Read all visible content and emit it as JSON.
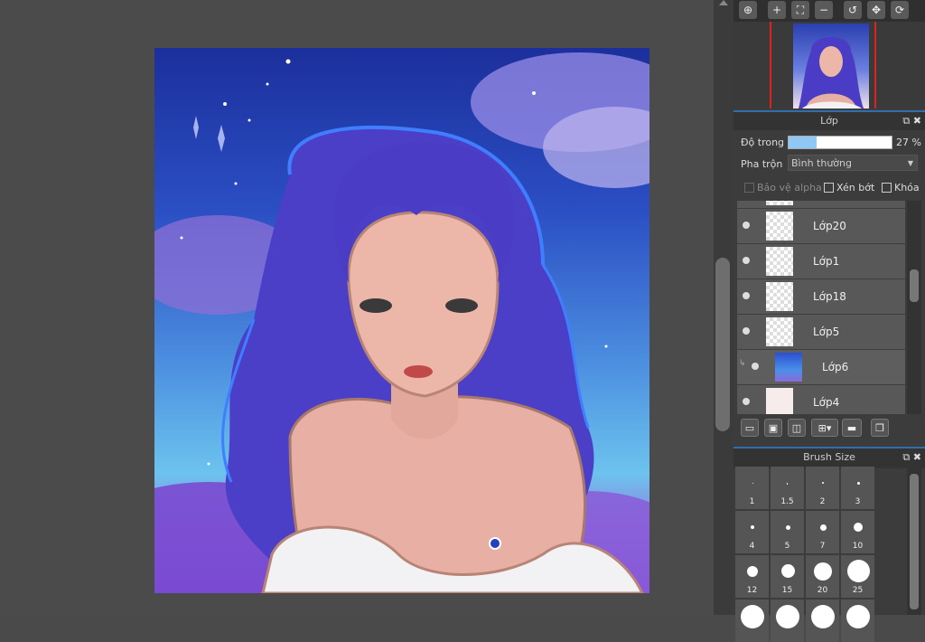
{
  "navigator": {
    "toolbar_icons": [
      "zoom-actual-icon",
      "zoom-in-icon",
      "fit-window-icon",
      "zoom-out-icon",
      "rotate-left-icon",
      "fullscreen-icon",
      "rotate-reset-icon"
    ]
  },
  "layer_panel": {
    "title": "Lớp",
    "opacity_label": "Độ trong",
    "opacity_value": "27 %",
    "opacity_fraction": 0.27,
    "blend_label": "Pha trộn",
    "blend_value": "Bình thường",
    "protect_alpha_label": "Bảo vệ alpha",
    "clipping_label": "Xén bớt",
    "lock_label": "Khóa",
    "layers": [
      {
        "name": "Lớp20",
        "thumb": "empty"
      },
      {
        "name": "Lớp1",
        "thumb": "empty"
      },
      {
        "name": "Lớp18",
        "thumb": "empty"
      },
      {
        "name": "Lớp5",
        "thumb": "empty"
      },
      {
        "name": "Lớp6",
        "thumb": "gradient"
      },
      {
        "name": "Lớp4",
        "thumb": "sketch"
      }
    ]
  },
  "brush_panel": {
    "title": "Brush Size",
    "sizes": [
      "1",
      "1.5",
      "2",
      "3",
      "4",
      "5",
      "7",
      "10",
      "12",
      "15",
      "20",
      "25"
    ]
  },
  "colors": {
    "accent": "#2f6fb0",
    "opacity_fill": "#8fc8f4",
    "panel_bg": "#3c3c3c",
    "workspace_bg": "#4b4b4b"
  }
}
